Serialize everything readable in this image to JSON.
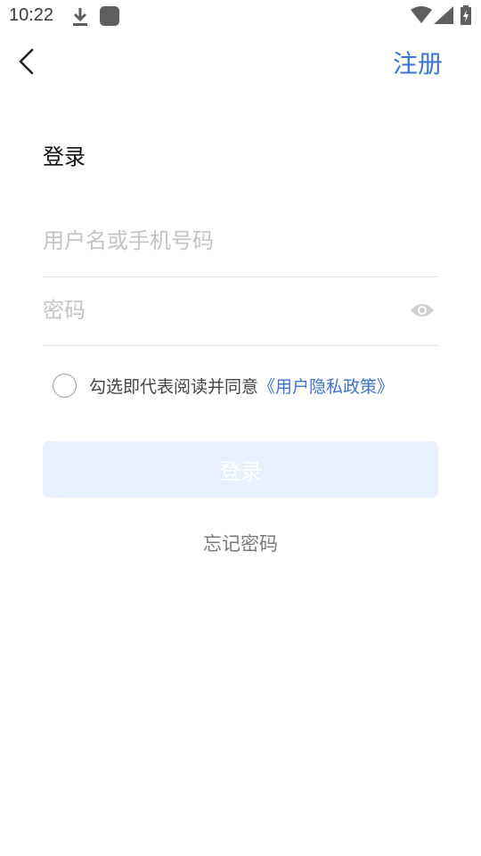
{
  "status_bar": {
    "time": "10:22"
  },
  "nav": {
    "register_label": "注册"
  },
  "page": {
    "title": "登录"
  },
  "form": {
    "username_placeholder": "用户名或手机号码",
    "username_value": "",
    "password_placeholder": "密码",
    "password_value": ""
  },
  "agreement": {
    "checked": false,
    "text": "勾选即代表阅读并同意",
    "policy_link": "《用户隐私政策》"
  },
  "actions": {
    "login_label": "登录",
    "forgot_label": "忘记密码"
  },
  "colors": {
    "accent": "#3b73d6",
    "login_button_disabled_bg": "#e8effd"
  }
}
